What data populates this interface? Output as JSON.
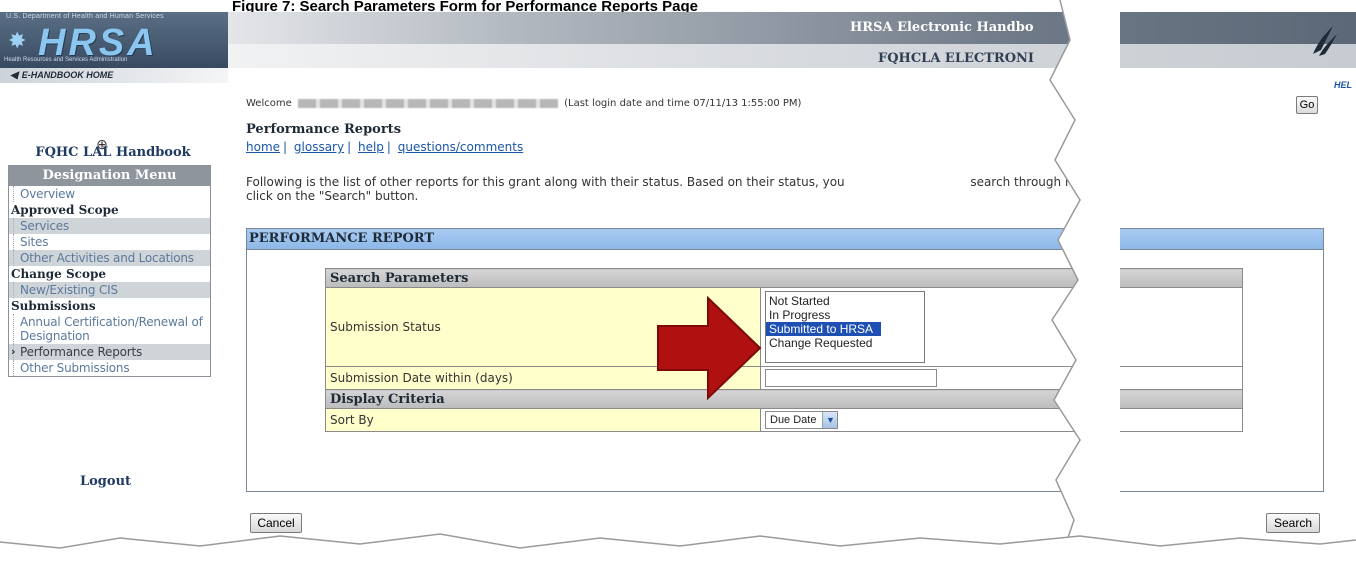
{
  "figure_caption": "Figure 7: Search Parameters Form for Performance Reports Page",
  "header": {
    "logo_text": "HRSA",
    "logo_top_text": "U.S. Department of Health and Human Services",
    "logo_bottom_text": "Health Resources and Services Administration",
    "banner_title": "HRSA Electronic Handbo",
    "banner_subtitle": "FQHCLA ELECTRONI",
    "home_link": "E-HANDBOOK HOME",
    "help_link": "HEL"
  },
  "sidebar": {
    "handbook_title": "FQHC LAL Handbook",
    "menu_title": "Designation Menu",
    "items": [
      {
        "type": "item",
        "label": "Overview"
      },
      {
        "type": "section",
        "label": "Approved Scope"
      },
      {
        "type": "item",
        "label": "Services",
        "shaded": true
      },
      {
        "type": "item",
        "label": "Sites"
      },
      {
        "type": "item",
        "label": "Other Activities and Locations",
        "shaded": true
      },
      {
        "type": "section",
        "label": "Change Scope"
      },
      {
        "type": "item",
        "label": "New/Existing CIS",
        "shaded": true
      },
      {
        "type": "section",
        "label": "Submissions"
      },
      {
        "type": "item",
        "label": "Annual Certification/Renewal of Designation"
      },
      {
        "type": "item",
        "label": "Performance Reports",
        "current": true
      },
      {
        "type": "item",
        "label": "Other Submissions"
      }
    ],
    "logout": "Logout"
  },
  "main": {
    "welcome_prefix": "Welcome",
    "last_login": "(Last login date and time 07/11/13 1:55:00 PM)",
    "go_button": "Go",
    "page_heading": "Performance Reports",
    "links": [
      "home",
      "glossary",
      "help",
      "questions/comments"
    ],
    "intro_part1": "Following is the list of other reports for this grant along with their status. Based on their status, you",
    "intro_part2": "search through reports,",
    "intro_line2": "click on the \"Search\" button.",
    "panel_title": "PERFORMANCE REPORT",
    "search_parameters_heading": "Search Parameters",
    "submission_status_label": "Submission Status",
    "status_options": [
      "Not Started",
      "In Progress",
      "Submitted to HRSA",
      "Change Requested"
    ],
    "status_selected": "Submitted to HRSA",
    "submission_date_label": "Submission Date within (days)",
    "submission_date_value": "",
    "display_criteria_heading": "Display Criteria",
    "sort_by_label": "Sort By",
    "sort_by_value": "Due Date",
    "cancel_button": "Cancel",
    "search_button": "Search"
  },
  "colors": {
    "callout_arrow": "#b01010",
    "panel_header": "#9ec2ee",
    "label_cell": "#ffffcc",
    "selected_option": "#1e4fb3"
  }
}
